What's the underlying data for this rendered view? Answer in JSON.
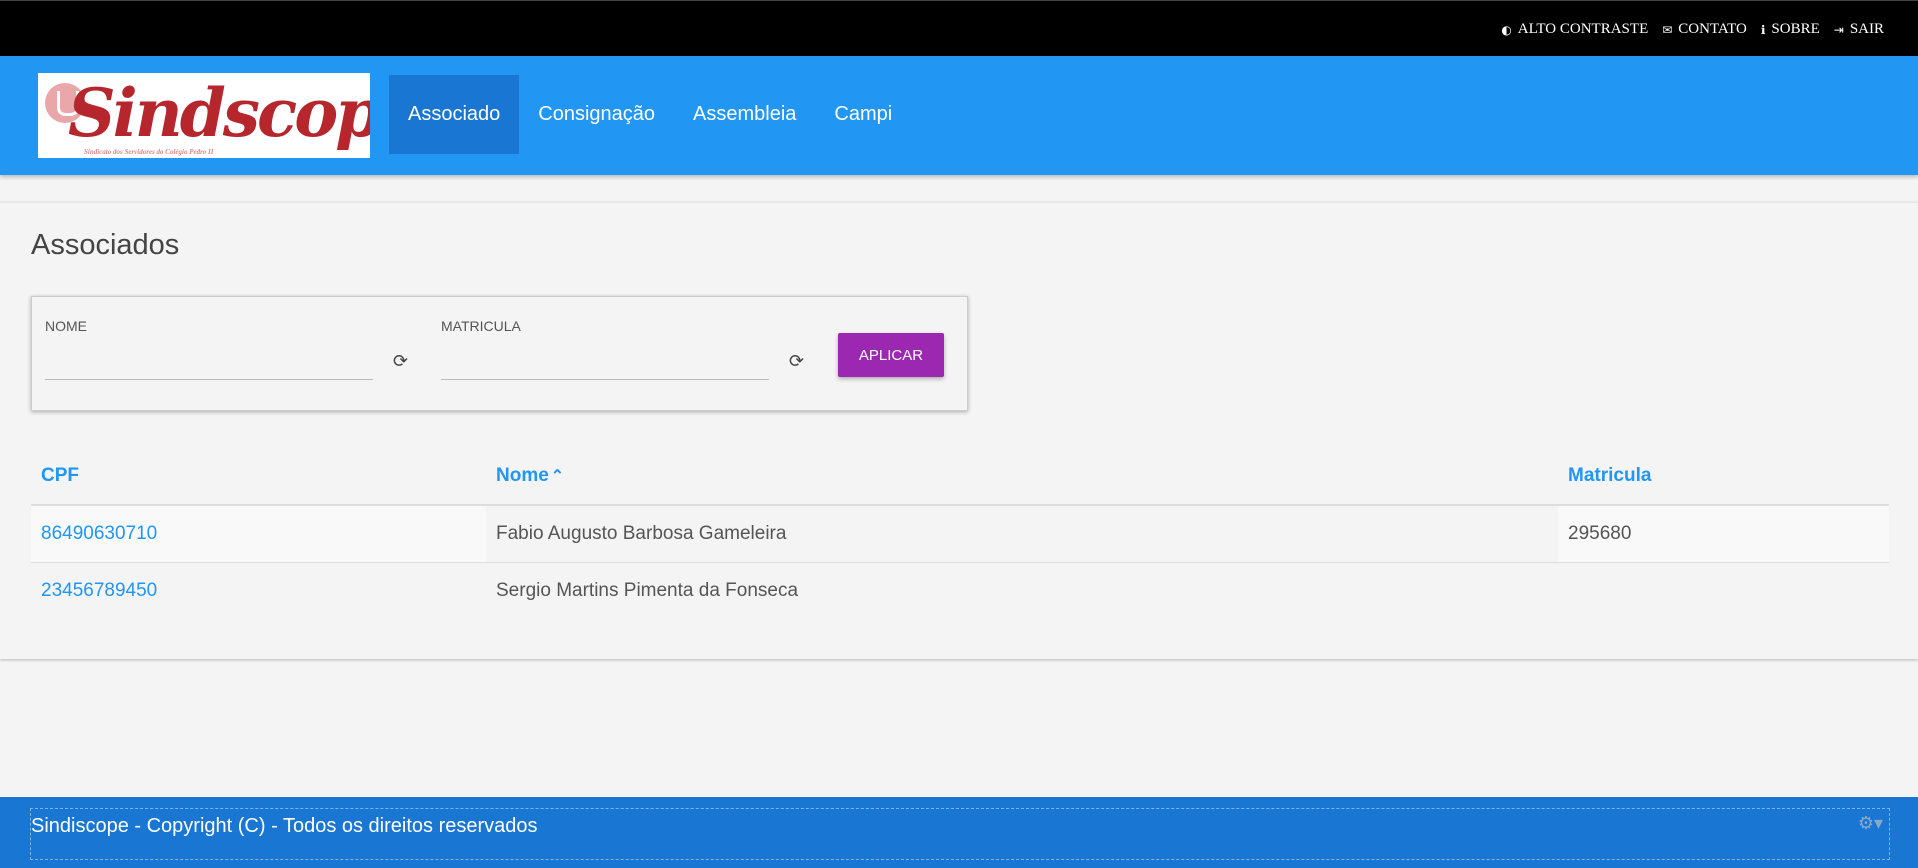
{
  "topbar": {
    "links": [
      {
        "label": "ALTO CONTRASTE",
        "icon": "contrast-icon"
      },
      {
        "label": "CONTATO",
        "icon": "envelope-icon"
      },
      {
        "label": "SOBRE",
        "icon": "info-icon"
      },
      {
        "label": "SAIR",
        "icon": "sign-out-icon"
      }
    ]
  },
  "brand": {
    "name": "Sindscope",
    "subtitle": "Sindicato dos Servidores do Colégio Pedro II"
  },
  "menu": {
    "items": [
      {
        "label": "Associado",
        "active": true
      },
      {
        "label": "Consignação",
        "active": false
      },
      {
        "label": "Assembleia",
        "active": false
      },
      {
        "label": "Campi",
        "active": false
      }
    ]
  },
  "page": {
    "title": "Associados"
  },
  "filters": {
    "nome_label": "NOME",
    "nome_value": "",
    "matricula_label": "MATRICULA",
    "matricula_value": "",
    "apply_label": "APLICAR"
  },
  "table": {
    "columns": [
      "CPF",
      "Nome",
      "Matricula"
    ],
    "sorted_column": "Nome",
    "sort_direction": "ascending",
    "rows": [
      {
        "cpf": "86490630710",
        "nome": "Fabio Augusto Barbosa Gameleira",
        "matricula": "295680"
      },
      {
        "cpf": "23456789450",
        "nome": "Sergio Martins Pimenta da Fonseca",
        "matricula": ""
      }
    ]
  },
  "footer": {
    "text": "Sindiscope - Copyright (C) - Todos os direitos reservados"
  },
  "colors": {
    "topbar": "#000000",
    "navbar": "#2196f3",
    "active_menu": "#1976d2",
    "apply_button": "#9c27b0",
    "link": "#2196f3",
    "footer": "#1976d2"
  }
}
